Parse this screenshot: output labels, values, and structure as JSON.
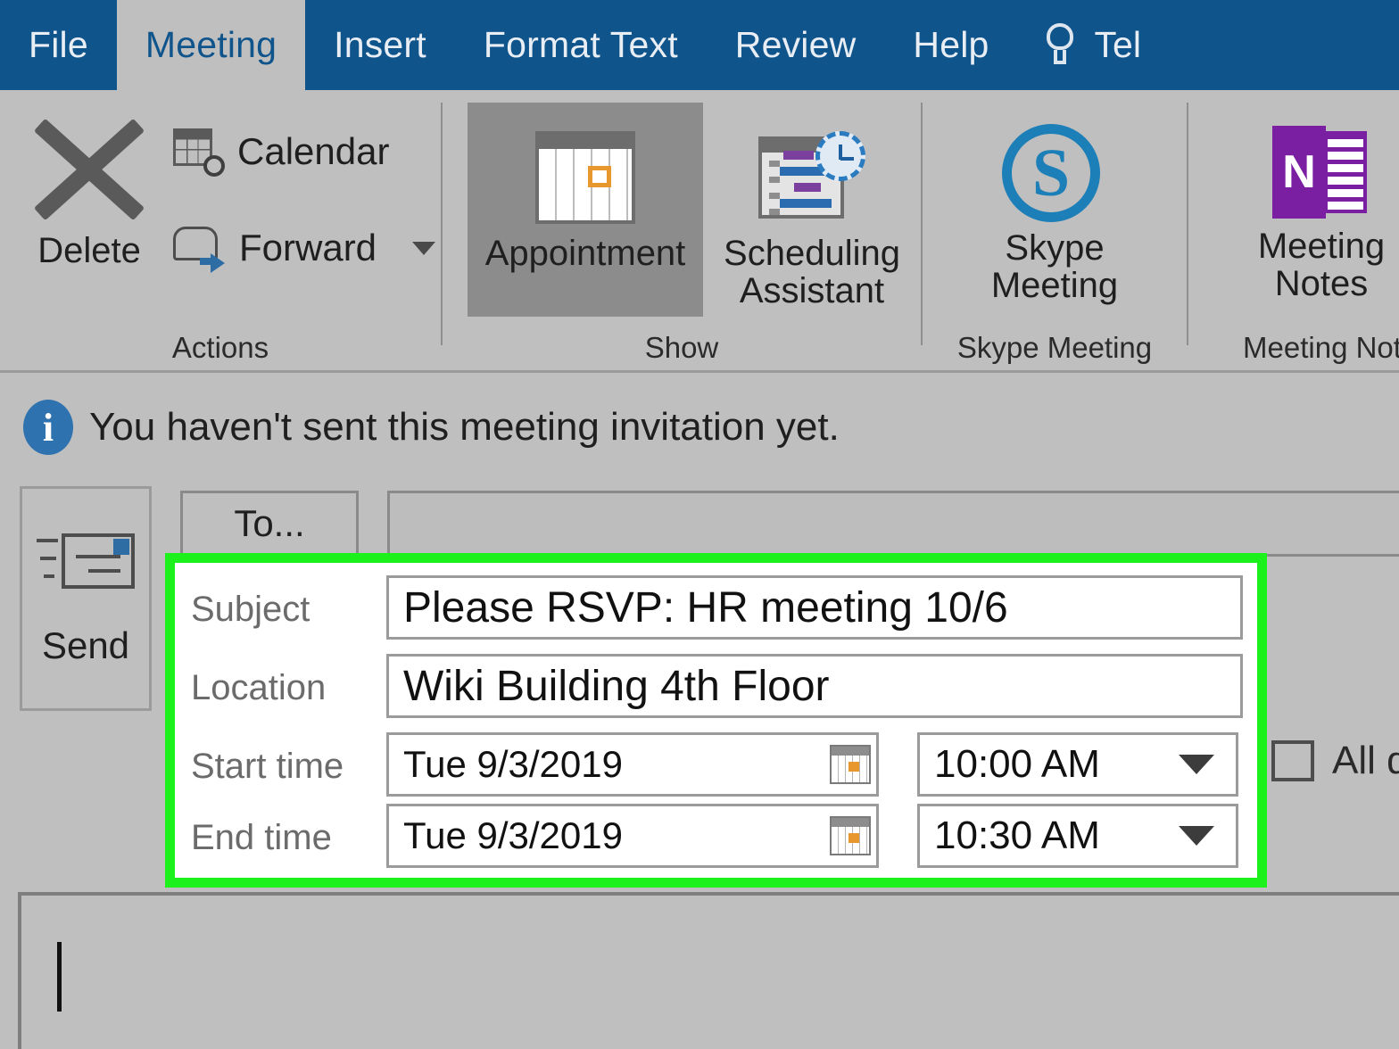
{
  "window": {
    "app": "Outlook Meeting",
    "theme_blue": "#10548C",
    "surface_gray": "#BFBFBF",
    "highlight_green": "#1CF11C"
  },
  "ribbon": {
    "tabs": [
      {
        "label": "File",
        "active": false
      },
      {
        "label": "Meeting",
        "active": true
      },
      {
        "label": "Insert",
        "active": false
      },
      {
        "label": "Format Text",
        "active": false
      },
      {
        "label": "Review",
        "active": false
      },
      {
        "label": "Help",
        "active": false
      }
    ],
    "tell_me": {
      "label": "Tel",
      "icon": "lightbulb-icon"
    },
    "groups": [
      {
        "name": "Actions",
        "label": "Actions",
        "buttons": [
          {
            "label": "Delete",
            "icon": "delete-x-icon"
          },
          {
            "label": "Calendar",
            "icon": "calendar-search-icon"
          },
          {
            "label": "Forward",
            "icon": "forward-envelope-icon",
            "has_dropdown": true
          }
        ]
      },
      {
        "name": "Show",
        "label": "Show",
        "buttons": [
          {
            "label": "Appointment",
            "icon": "appointment-calendar-icon",
            "selected": true
          },
          {
            "label": "Scheduling\nAssistant",
            "icon": "scheduling-assistant-icon",
            "selected": false
          }
        ]
      },
      {
        "name": "Skype Meeting",
        "label": "Skype Meeting",
        "buttons": [
          {
            "label": "Skype\nMeeting",
            "icon": "skype-icon"
          }
        ]
      },
      {
        "name": "Meeting Notes",
        "label": "Meeting Not",
        "buttons": [
          {
            "label": "Meeting\nNotes",
            "icon": "onenote-icon"
          }
        ]
      }
    ]
  },
  "infobar": {
    "icon": "info-icon",
    "glyph": "i",
    "message": "You haven't sent this meeting invitation yet."
  },
  "compose": {
    "send_button": {
      "label": "Send",
      "icon": "send-envelope-icon"
    },
    "to_button": {
      "label": "To..."
    },
    "to_field": {
      "value": "",
      "placeholder": ""
    },
    "fields": {
      "subject": {
        "label": "Subject",
        "value": "Please RSVP: HR meeting 10/6"
      },
      "location": {
        "label": "Location",
        "value": "Wiki Building 4th Floor"
      },
      "start_time": {
        "label": "Start time",
        "date": "Tue 9/3/2019",
        "time": "10:00 AM"
      },
      "end_time": {
        "label": "End time",
        "date": "Tue 9/3/2019",
        "time": "10:30 AM"
      }
    },
    "all_day": {
      "label": "All da",
      "checked": false
    }
  },
  "body": {
    "content": ""
  }
}
